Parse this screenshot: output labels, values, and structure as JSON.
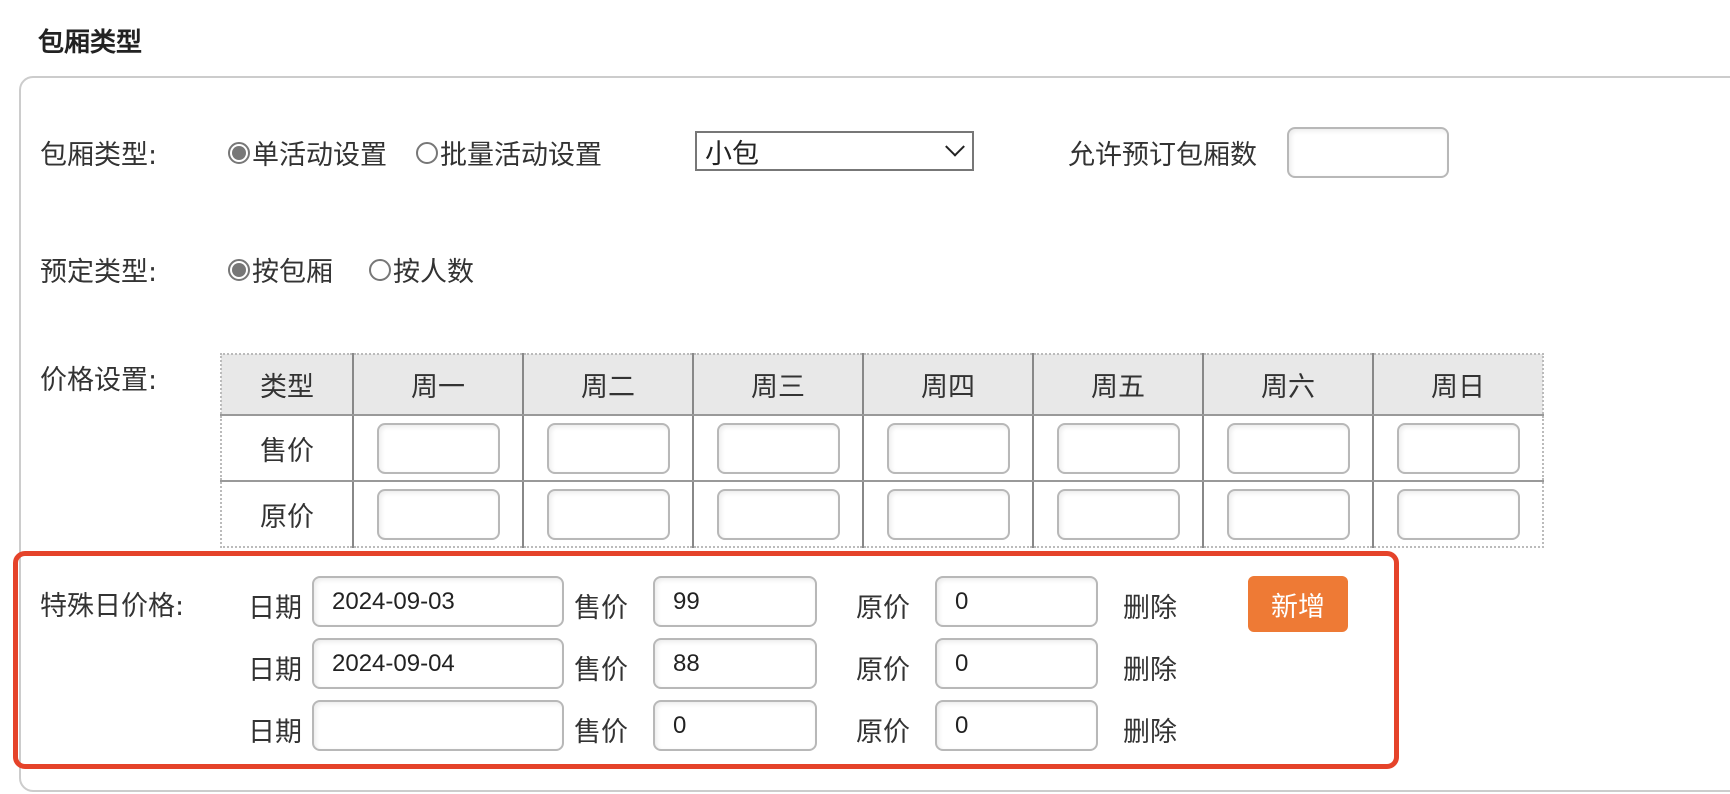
{
  "section_title": "包厢类型",
  "room_type": {
    "label": "包厢类型:",
    "options": [
      {
        "label": "单活动设置",
        "checked": true
      },
      {
        "label": "批量活动设置",
        "checked": false
      }
    ],
    "select_value": "小包",
    "allow_count_label": "允许预订包厢数",
    "allow_count_value": ""
  },
  "booking_type": {
    "label": "预定类型:",
    "options": [
      {
        "label": "按包厢",
        "checked": true
      },
      {
        "label": "按人数",
        "checked": false
      }
    ]
  },
  "price_settings": {
    "label": "价格设置:",
    "headers": [
      "类型",
      "周一",
      "周二",
      "周三",
      "周四",
      "周五",
      "周六",
      "周日"
    ],
    "rows": [
      {
        "type": "售价",
        "values": [
          "",
          "",
          "",
          "",
          "",
          "",
          ""
        ]
      },
      {
        "type": "原价",
        "values": [
          "",
          "",
          "",
          "",
          "",
          "",
          ""
        ]
      }
    ]
  },
  "special_price": {
    "label": "特殊日价格:",
    "date_label": "日期",
    "sale_label": "售价",
    "orig_label": "原价",
    "delete_label": "删除",
    "add_label": "新增",
    "rows": [
      {
        "date": "2024-09-03",
        "sale": "99",
        "orig": "0"
      },
      {
        "date": "2024-09-04",
        "sale": "88",
        "orig": "0"
      },
      {
        "date": "",
        "sale": "0",
        "orig": "0"
      }
    ]
  },
  "colors": {
    "highlight_border": "#e5432a",
    "add_button": "#ee7a35"
  }
}
